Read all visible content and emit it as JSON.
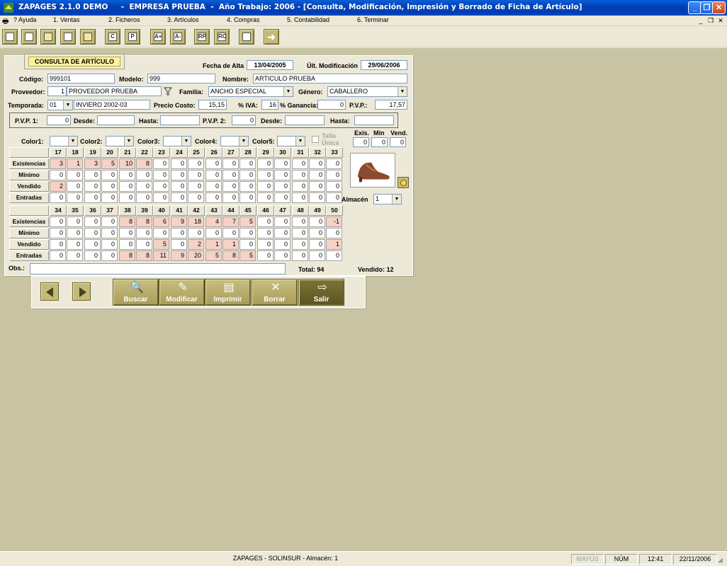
{
  "window": {
    "title": "ZAPAGES 2.1.0 DEMO     -  EMPRESA PRUEBA  -  Año Trabajo: 2006 - [Consulta, Modificación, Impresión y Borrado de Ficha de Artículo]",
    "minimize": "_",
    "maximize": "❐",
    "close": "✕"
  },
  "menu": [
    "? Ayuda",
    "1. Ventas",
    "2. Ficheros",
    "3. Artículos",
    "4. Compras",
    "5. Contabilidad",
    "6. Terminar"
  ],
  "toolbar_icons": [
    "form-icon",
    "edit-icon",
    "list-icon",
    "list2-icon",
    "report-icon",
    "c-icon",
    "p-icon",
    "a-plus-icon",
    "a-minus-icon",
    "rp-icon",
    "rc-icon",
    "save-icon",
    "next-icon"
  ],
  "toolbar_letters": {
    "c": "C",
    "p": "P",
    "a_plus": "A+",
    "a_minus": "A-",
    "rp": "RP",
    "rc": "RC"
  },
  "form": {
    "title": "CONSULTA DE ARTÍCULO",
    "fecha_alta_label": "Fecha de Alta",
    "fecha_alta": "13/04/2005",
    "ult_mod_label": "Últ. Modificación",
    "ult_mod": "29/06/2006",
    "codigo_label": "Código:",
    "codigo": "999101",
    "modelo_label": "Modelo:",
    "modelo": "999",
    "nombre_label": "Nombre:",
    "nombre": "ARTICULO PRUEBA",
    "proveedor_label": "Proveedor:",
    "proveedor_code": "1",
    "proveedor_name": "PROVEEDOR PRUEBA",
    "familia_label": "Familia:",
    "familia": "ANCHO ESPECIAL",
    "genero_label": "Género:",
    "genero": "CABALLERO",
    "temporada_label": "Temporada:",
    "temporada_code": "01",
    "temporada_name": "INVIERO 2002-03",
    "precio_costo_label": "Precio Costo:",
    "precio_costo": "15,15",
    "iva_label": "% IVA:",
    "iva": "16",
    "ganancia_label": "% Ganancia:",
    "ganancia": "0",
    "pvp_label": "P.V.P.:",
    "pvp": "17,57",
    "pvp1_label": "P.V.P. 1:",
    "pvp1": "0",
    "desde_label": "Desde:",
    "hasta_label": "Hasta:",
    "pvp2_label": "P.V.P. 2:",
    "pvp2": "0",
    "colors": [
      "Color1:",
      "Color2:",
      "Color3:",
      "Color4:",
      "Color5:"
    ],
    "talla_unica_1": "Talla",
    "talla_unica_2": "Única",
    "exis_label": "Exis.",
    "min_label": "Min",
    "vend_label": "Vend.",
    "exis": "0",
    "min": "0",
    "vend": "0",
    "almacen_label": "Almacén",
    "almacen": "1",
    "obs_label": "Obs.:",
    "total_label": "Total: 94",
    "vendido_label": "Vendido: 12"
  },
  "grid1": {
    "sizes": [
      "17",
      "18",
      "19",
      "20",
      "21",
      "22",
      "23",
      "24",
      "25",
      "26",
      "27",
      "28",
      "29",
      "30",
      "31",
      "32",
      "33"
    ],
    "rows": [
      {
        "label": "Existencias",
        "values": [
          "3",
          "1",
          "3",
          "5",
          "10",
          "8",
          "0",
          "0",
          "0",
          "0",
          "0",
          "0",
          "0",
          "0",
          "0",
          "0",
          "0"
        ]
      },
      {
        "label": "Mínimo",
        "values": [
          "0",
          "0",
          "0",
          "0",
          "0",
          "0",
          "0",
          "0",
          "0",
          "0",
          "0",
          "0",
          "0",
          "0",
          "0",
          "0",
          "0"
        ]
      },
      {
        "label": "Vendido",
        "values": [
          "2",
          "0",
          "0",
          "0",
          "0",
          "0",
          "0",
          "0",
          "0",
          "0",
          "0",
          "0",
          "0",
          "0",
          "0",
          "0",
          "0"
        ]
      },
      {
        "label": "Entradas",
        "values": [
          "0",
          "0",
          "0",
          "0",
          "0",
          "0",
          "0",
          "0",
          "0",
          "0",
          "0",
          "0",
          "0",
          "0",
          "0",
          "0",
          "0"
        ]
      }
    ]
  },
  "grid2": {
    "sizes": [
      "34",
      "35",
      "36",
      "37",
      "38",
      "39",
      "40",
      "41",
      "42",
      "43",
      "44",
      "45",
      "46",
      "47",
      "48",
      "49",
      "50"
    ],
    "rows": [
      {
        "label": "Existencias",
        "values": [
          "0",
          "0",
          "0",
          "0",
          "8",
          "8",
          "6",
          "9",
          "18",
          "4",
          "7",
          "5",
          "0",
          "0",
          "0",
          "0",
          "-1"
        ]
      },
      {
        "label": "Mínimo",
        "values": [
          "0",
          "0",
          "0",
          "0",
          "0",
          "0",
          "0",
          "0",
          "0",
          "0",
          "0",
          "0",
          "0",
          "0",
          "0",
          "0",
          "0"
        ]
      },
      {
        "label": "Vendido",
        "values": [
          "0",
          "0",
          "0",
          "0",
          "0",
          "0",
          "5",
          "0",
          "2",
          "1",
          "1",
          "0",
          "0",
          "0",
          "0",
          "0",
          "1"
        ]
      },
      {
        "label": "Entradas",
        "values": [
          "0",
          "0",
          "0",
          "0",
          "8",
          "8",
          "11",
          "9",
          "20",
          "5",
          "8",
          "5",
          "0",
          "0",
          "0",
          "0",
          "0"
        ]
      }
    ]
  },
  "buttons": {
    "buscar": "Buscar",
    "modificar": "Modificar",
    "imprimir": "Imprimir",
    "borrar": "Borrar",
    "salir": "Salir"
  },
  "status": {
    "app": "ZAPAGES  -  SOLINSUR  -  Almacén: 1",
    "mayus": "MAYÚS",
    "num": "NÚM",
    "time": "12:41",
    "date": "22/11/2006"
  },
  "colors": {
    "accent": "#C3B979",
    "highlight": "#F6D2C4",
    "title_bg": "#FFF39A",
    "workspace": "#C7C3A3"
  }
}
